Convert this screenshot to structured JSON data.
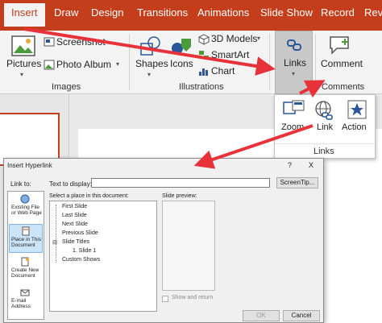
{
  "tabs": [
    "Insert",
    "Draw",
    "Design",
    "Transitions",
    "Animations",
    "Slide Show",
    "Record",
    "Rev"
  ],
  "ribbon": {
    "pictures": "Pictures",
    "screenshot": "Screenshot",
    "photo_album": "Photo Album",
    "images_group": "Images",
    "shapes": "Shapes",
    "icons": "Icons",
    "models_3d": "3D Models",
    "smartart": "SmartArt",
    "chart": "Chart",
    "illustrations_group": "Illustrations",
    "links": "Links",
    "comment": "Comment",
    "comments_group": "Comments"
  },
  "links_dropdown": {
    "zoom": "Zoom",
    "link": "Link",
    "action": "Action",
    "group": "Links"
  },
  "dialog": {
    "title": "Insert Hyperlink",
    "help": "?",
    "close": "X",
    "link_to": "Link to:",
    "text_to_display": "Text to display:",
    "text_value": "",
    "screentip": "ScreenTip...",
    "place_heading": "Select a place in this document:",
    "preview_heading": "Slide preview:",
    "nav": [
      "Existing File or Web Page",
      "Place in This Document",
      "Create New Document",
      "E-mail Address"
    ],
    "tree": [
      "First Slide",
      "Last Slide",
      "Next Slide",
      "Previous Slide",
      "Slide Titles",
      "1. Slide 1",
      "Custom Shows"
    ],
    "show_and_return": "Show and return",
    "ok": "OK",
    "cancel": "Cancel"
  },
  "colors": {
    "accent": "#c43e1c",
    "arrow": "#e8323a",
    "link_blue": "#2b579a"
  }
}
